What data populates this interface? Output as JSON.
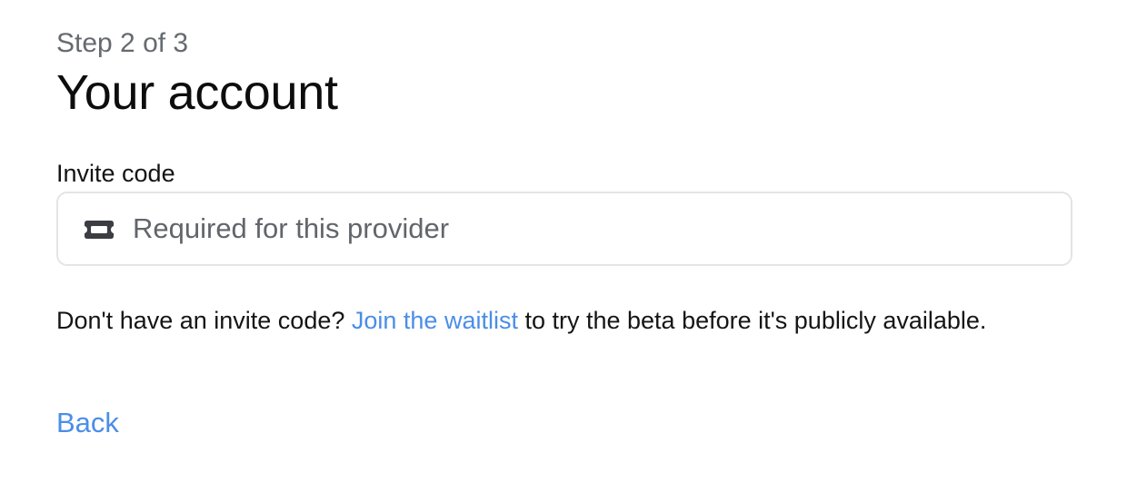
{
  "header": {
    "step_text": "Step 2 of 3",
    "title": "Your account"
  },
  "invite_code": {
    "label": "Invite code",
    "value": "",
    "placeholder": "Required for this provider",
    "icon": "ticket-icon"
  },
  "help": {
    "prefix": "Don't have an invite code? ",
    "link_text": "Join the waitlist",
    "suffix": " to try the beta before it's publicly available."
  },
  "navigation": {
    "back_label": "Back"
  },
  "colors": {
    "link": "#4a8ee8",
    "muted_text": "#666a70",
    "border": "#e3e4e6"
  }
}
